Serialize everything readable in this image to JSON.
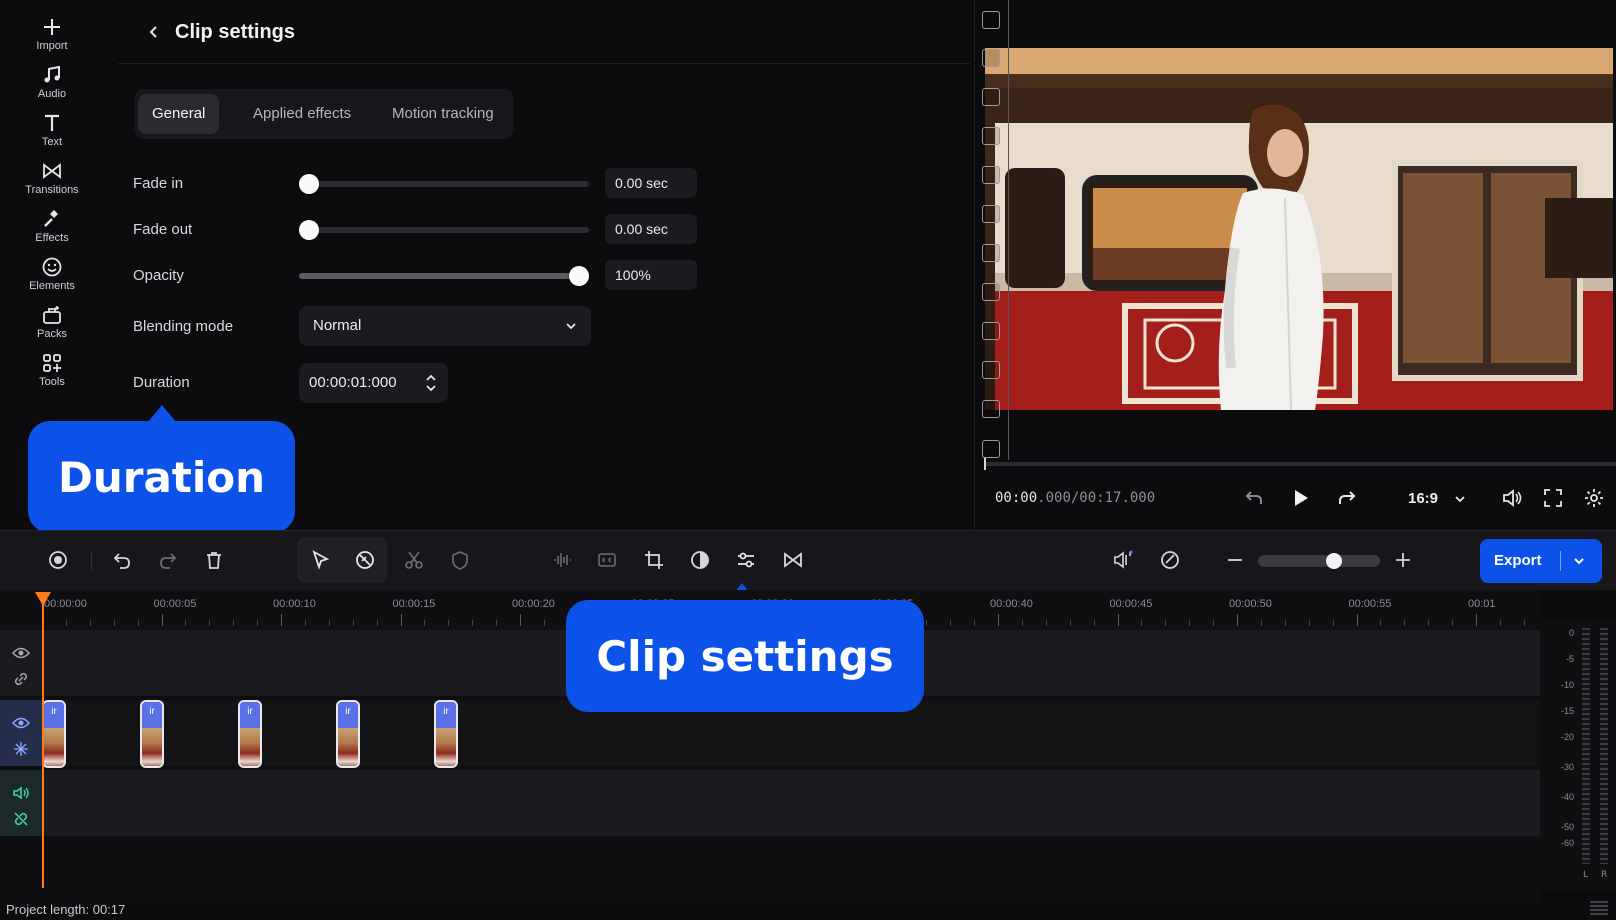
{
  "sidebar": {
    "items": [
      {
        "label": "Import",
        "icon": "plus-icon"
      },
      {
        "label": "Audio",
        "icon": "music-note-icon"
      },
      {
        "label": "Text",
        "icon": "text-icon"
      },
      {
        "label": "Transitions",
        "icon": "transitions-icon"
      },
      {
        "label": "Effects",
        "icon": "effects-icon"
      },
      {
        "label": "Elements",
        "icon": "smiley-icon"
      },
      {
        "label": "Packs",
        "icon": "packs-icon"
      },
      {
        "label": "Tools",
        "icon": "tools-grid-icon"
      }
    ]
  },
  "panel": {
    "title": "Clip settings",
    "tabs": [
      {
        "label": "General",
        "active": true
      },
      {
        "label": "Applied effects",
        "active": false
      },
      {
        "label": "Motion tracking",
        "active": false
      }
    ],
    "fade_in": {
      "label": "Fade in",
      "value": "0.00 sec",
      "fraction": 0.0
    },
    "fade_out": {
      "label": "Fade out",
      "value": "0.00 sec",
      "fraction": 0.0
    },
    "opacity": {
      "label": "Opacity",
      "value": "100%",
      "fraction": 1.0
    },
    "blending_mode": {
      "label": "Blending mode",
      "value": "Normal"
    },
    "duration": {
      "label": "Duration",
      "value": "00:00:01:000"
    }
  },
  "callouts": {
    "duration": "Duration",
    "clip_settings": "Clip settings"
  },
  "preview": {
    "timecode_current": "00:00",
    "timecode_rest": ".000/00:17.000",
    "aspect_ratio": "16:9"
  },
  "toolbar": {
    "export_label": "Export"
  },
  "ruler": {
    "ticks": [
      "00:00:00",
      "00:00:05",
      "00:00:10",
      "00:00:15",
      "00:00:20",
      "00:00:25",
      "00:00:30",
      "00:00:35",
      "00:00:40",
      "00:00:45",
      "00:00:50",
      "00:00:55",
      "00:01"
    ]
  },
  "timeline": {
    "clip_tag": "ir",
    "clip_count": 5
  },
  "meter": {
    "labels": [
      "0",
      "-5",
      "-10",
      "-15",
      "-20",
      "-30",
      "-40",
      "-50",
      "-60"
    ],
    "left": "L",
    "right": "R"
  },
  "status": {
    "project_length": "Project length: 00:17"
  },
  "colors": {
    "accent": "#0d52e8",
    "playhead": "#ff7a1a",
    "clip_header": "#5b6fe6"
  }
}
